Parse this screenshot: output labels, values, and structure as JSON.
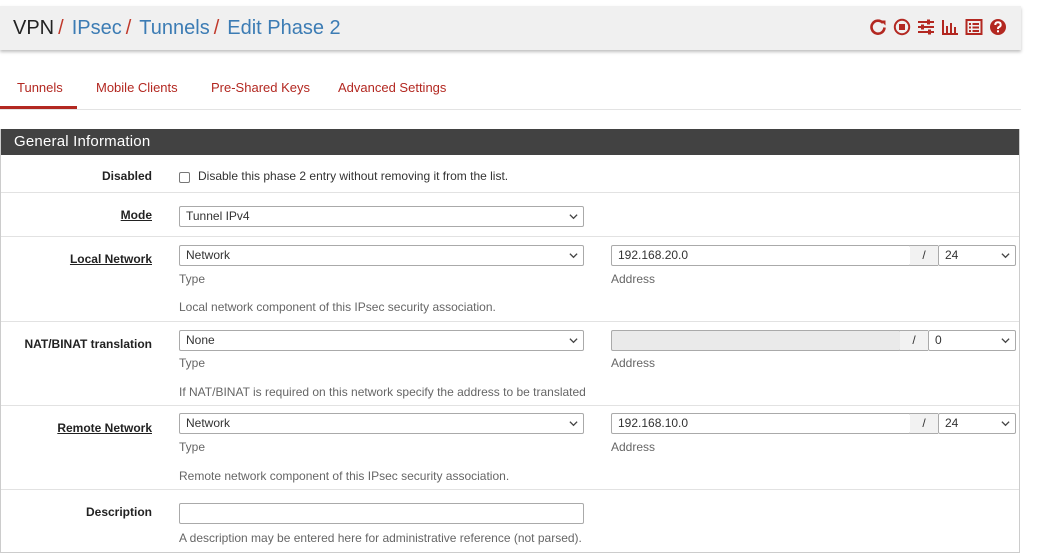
{
  "breadcrumb": {
    "root": "VPN",
    "items": [
      "IPsec",
      "Tunnels",
      "Edit Phase 2"
    ],
    "separator": "/"
  },
  "header_icons": [
    "reload-icon",
    "stop-icon",
    "sliders-icon",
    "chart-icon",
    "list-icon",
    "help-icon"
  ],
  "tabs": [
    {
      "label": "Tunnels",
      "active": true
    },
    {
      "label": "Mobile Clients",
      "active": false
    },
    {
      "label": "Pre-Shared Keys",
      "active": false
    },
    {
      "label": "Advanced Settings",
      "active": false
    }
  ],
  "panel": {
    "title": "General Information",
    "disabled": {
      "label": "Disabled",
      "checkbox_text": "Disable this phase 2 entry without removing it from the list.",
      "checked": false
    },
    "mode": {
      "label": "Mode",
      "value": "Tunnel IPv4"
    },
    "local_network": {
      "label": "Local Network",
      "type_value": "Network",
      "type_sub": "Type",
      "address_value": "192.168.20.0",
      "address_sub": "Address",
      "slash": "/",
      "mask_value": "24",
      "help": "Local network component of this IPsec security association."
    },
    "nat": {
      "label": "NAT/BINAT translation",
      "type_value": "None",
      "type_sub": "Type",
      "address_value": "",
      "address_sub": "Address",
      "slash": "/",
      "mask_value": "0",
      "help": "If NAT/BINAT is required on this network specify the address to be translated"
    },
    "remote_network": {
      "label": "Remote Network",
      "type_value": "Network",
      "type_sub": "Type",
      "address_value": "192.168.10.0",
      "address_sub": "Address",
      "slash": "/",
      "mask_value": "24",
      "help": "Remote network component of this IPsec security association."
    },
    "description": {
      "label": "Description",
      "value": "",
      "help": "A description may be entered here for administrative reference (not parsed)."
    }
  },
  "colors": {
    "accent": "#b32821",
    "link": "#3c7cb4",
    "panel_head": "#424242",
    "header_bg": "#f0f0f0"
  }
}
